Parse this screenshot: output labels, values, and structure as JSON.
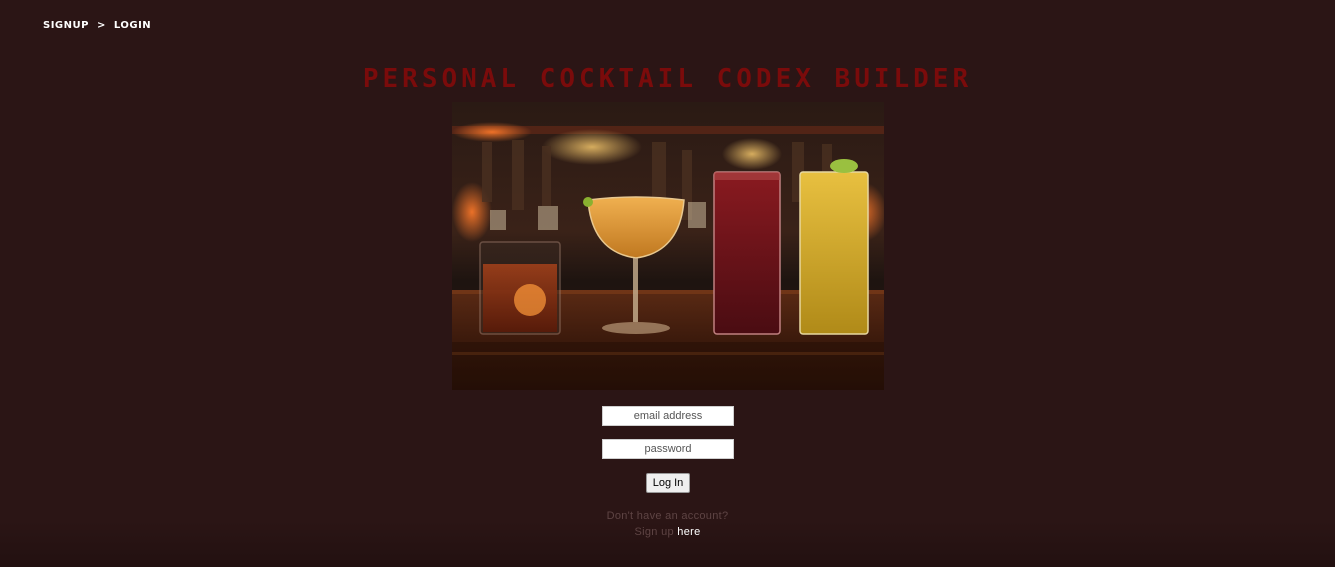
{
  "breadcrumb": {
    "signup": "SIGNUP",
    "separator": ">",
    "login": "LOGIN"
  },
  "title": "Personal Cocktail Codex Builder",
  "hero_image": {
    "subject": "cocktails-on-bar-photo"
  },
  "form": {
    "email_placeholder": "email address",
    "password_placeholder": "password",
    "login_label": "Log In"
  },
  "signup_prompt": {
    "line1": "Don't have an account?",
    "line2_prefix": "Sign up",
    "link": "here"
  },
  "colors": {
    "background": "#2b1515",
    "title": "#7a0b0b",
    "muted_text": "#5e4444",
    "link": "#ffffff"
  }
}
